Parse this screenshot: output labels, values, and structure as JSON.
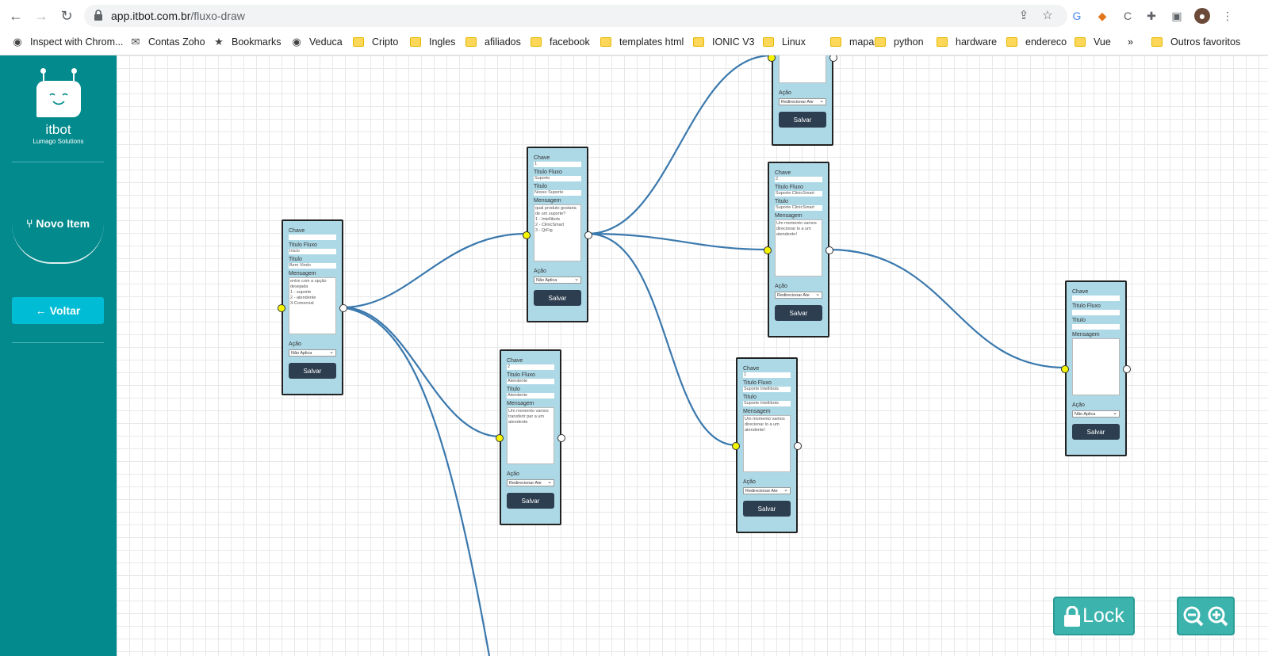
{
  "browser": {
    "url_host": "app.itbot.com.br",
    "url_path": "/fluxo-draw",
    "bookmarks": [
      {
        "label": "Inspect with Chrom...",
        "icon": "globe-icon"
      },
      {
        "label": "Contas Zoho",
        "icon": "zoho-icon"
      },
      {
        "label": "Bookmarks",
        "icon": "star-icon"
      },
      {
        "label": "Veduca",
        "icon": "globe-icon"
      },
      {
        "label": "Cripto",
        "icon": "folder-icon"
      },
      {
        "label": "Ingles",
        "icon": "folder-icon"
      },
      {
        "label": "afiliados",
        "icon": "folder-icon"
      },
      {
        "label": "facebook",
        "icon": "folder-icon"
      },
      {
        "label": "templates html",
        "icon": "folder-icon"
      },
      {
        "label": "IONIC V3",
        "icon": "folder-icon"
      },
      {
        "label": "Linux",
        "icon": "folder-icon"
      },
      {
        "label": "mapas",
        "icon": "folder-icon"
      },
      {
        "label": "python",
        "icon": "folder-icon"
      },
      {
        "label": "hardware",
        "icon": "folder-icon"
      },
      {
        "label": "endereco",
        "icon": "folder-icon"
      },
      {
        "label": "Vue",
        "icon": "folder-icon"
      }
    ],
    "more_bookmarks": "»",
    "other_favorites": "Outros favoritos"
  },
  "sidebar": {
    "logo_name": "itbot",
    "logo_sub": "Lumago Solutions",
    "new_item": "Novo Item",
    "back": "Voltar"
  },
  "labels": {
    "chave": "Chave",
    "titulo_fluxo": "Titulo Fluxo",
    "titulo": "Titulo",
    "mensagem": "Mensagem",
    "acao": "Ação",
    "salvar": "Salvar"
  },
  "nodes": [
    {
      "chave": "",
      "titulo_fluxo": "Inicio",
      "titulo": "Bem Vindo",
      "mensagem": "entre com a opção desejada\n1 - suporte\n2 - atendente\n3-Comercial",
      "acao": "Não Aplica"
    },
    {
      "chave": "1",
      "titulo_fluxo": "Suporte",
      "titulo": "Nosso Suporte",
      "mensagem": "qual produto gostaria de um suporte?\n1 - Intellibots\n2 - ClinicSmart\n3 - QrFig",
      "acao": "Não Aplica"
    },
    {
      "chave": "2",
      "titulo_fluxo": "Atendente",
      "titulo": "Atendente",
      "mensagem": "Um momento vamos transferir par a um atendente",
      "acao": "Redirecionar Ate"
    },
    {
      "chave": "",
      "titulo_fluxo": "",
      "titulo": "",
      "mensagem": "",
      "acao": "Redirecionar Ate"
    },
    {
      "chave": "2",
      "titulo_fluxo": "Suporte ClinicSmart",
      "titulo": "Suporte ClinicSmart",
      "mensagem": "Um momento vamos direcionar lo a um atendente!",
      "acao": "Redirecionar Ate"
    },
    {
      "chave": "1",
      "titulo_fluxo": "Suporte Intellibots",
      "titulo": "Suporte Intellibots",
      "mensagem": "Um momento vamos direcionar lo a um atendente!",
      "acao": "Redirecionar Ate"
    },
    {
      "chave": "",
      "titulo_fluxo": "",
      "titulo": "",
      "mensagem": "",
      "acao": "Não Aplica"
    }
  ],
  "controls": {
    "lock": "Lock"
  }
}
